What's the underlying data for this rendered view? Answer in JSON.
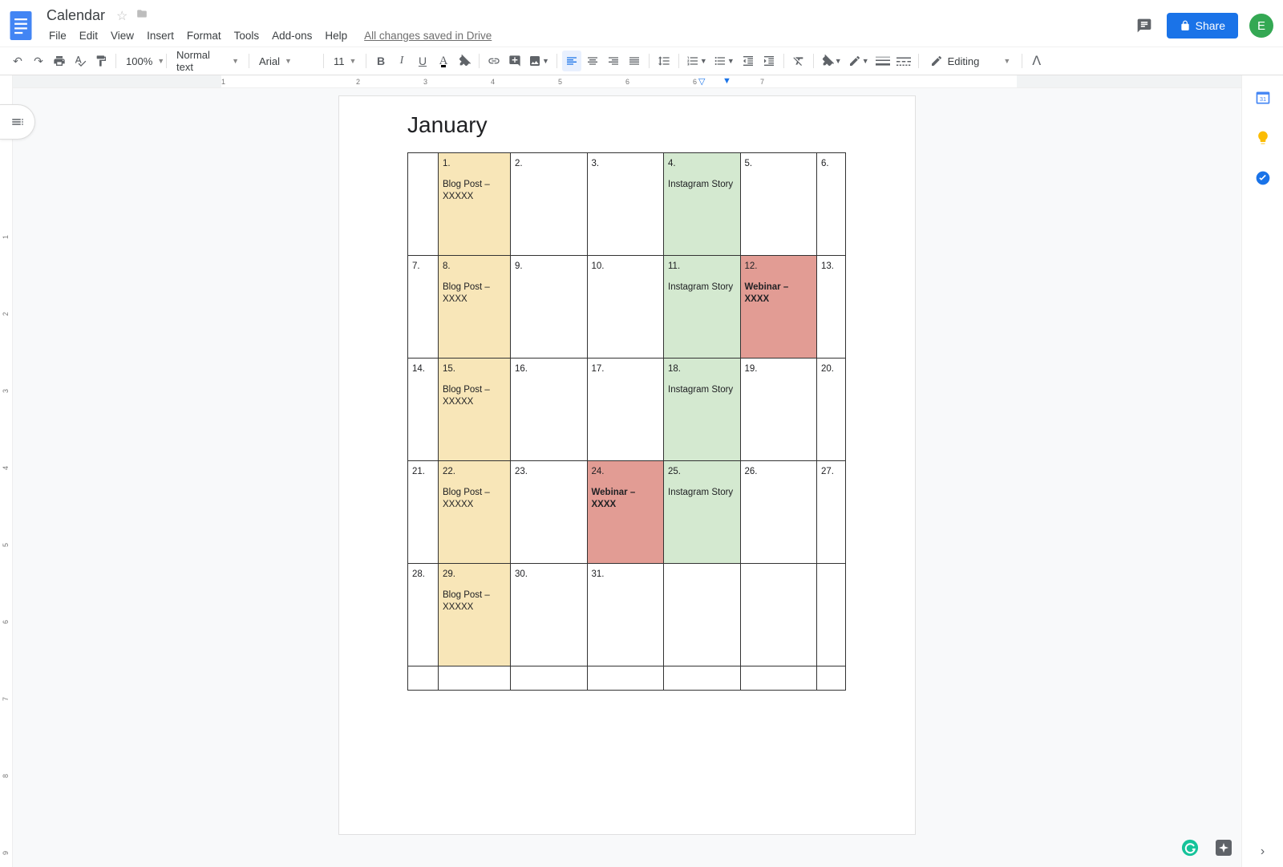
{
  "header": {
    "doc_title": "Calendar",
    "save_status": "All changes saved in Drive",
    "menus": [
      "File",
      "Edit",
      "View",
      "Insert",
      "Format",
      "Tools",
      "Add-ons",
      "Help"
    ],
    "share_label": "Share",
    "avatar_letter": "E"
  },
  "toolbar": {
    "zoom": "100%",
    "style": "Normal text",
    "font": "Arial",
    "size": "11",
    "mode": "Editing"
  },
  "ruler": {
    "top_numbers": [
      "1",
      "2",
      "3",
      "4",
      "5",
      "6",
      "7"
    ],
    "left_numbers": [
      "1",
      "2",
      "3",
      "4",
      "5",
      "6",
      "7",
      "8",
      "9"
    ]
  },
  "document": {
    "title": "January",
    "calendar": {
      "colors": {
        "blog": "bg-yellow",
        "insta": "bg-green",
        "webinar": "bg-red"
      },
      "rows": [
        [
          {
            "num": "",
            "text": "",
            "bg": ""
          },
          {
            "num": "1.",
            "text": "Blog Post  – XXXXX",
            "bg": "blog"
          },
          {
            "num": "2.",
            "text": "",
            "bg": ""
          },
          {
            "num": "3.",
            "text": "",
            "bg": ""
          },
          {
            "num": "4.",
            "text": "Instagram Story",
            "bg": "insta"
          },
          {
            "num": "5.",
            "text": "",
            "bg": ""
          },
          {
            "num": "6.",
            "text": "",
            "bg": ""
          }
        ],
        [
          {
            "num": "7.",
            "text": "",
            "bg": ""
          },
          {
            "num": "8.",
            "text": "Blog Post – XXXX",
            "bg": "blog"
          },
          {
            "num": "9.",
            "text": "",
            "bg": ""
          },
          {
            "num": "10.",
            "text": "",
            "bg": ""
          },
          {
            "num": "11.",
            "text": "Instagram Story",
            "bg": "insta"
          },
          {
            "num": "12.",
            "text": "Webinar – XXXX",
            "bg": "webinar",
            "bold": true
          },
          {
            "num": "13.",
            "text": "",
            "bg": ""
          }
        ],
        [
          {
            "num": "14.",
            "text": "",
            "bg": ""
          },
          {
            "num": "15.",
            "text": "Blog Post  – XXXXX",
            "bg": "blog"
          },
          {
            "num": "16.",
            "text": "",
            "bg": ""
          },
          {
            "num": "17.",
            "text": "",
            "bg": ""
          },
          {
            "num": "18.",
            "text": "Instagram Story",
            "bg": "insta"
          },
          {
            "num": "19.",
            "text": "",
            "bg": ""
          },
          {
            "num": "20.",
            "text": "",
            "bg": ""
          }
        ],
        [
          {
            "num": "21.",
            "text": "",
            "bg": ""
          },
          {
            "num": "22.",
            "text": "Blog Post  – XXXXX",
            "bg": "blog"
          },
          {
            "num": "23.",
            "text": "",
            "bg": ""
          },
          {
            "num": "24.",
            "text": "Webinar – XXXX",
            "bg": "webinar",
            "bold": true
          },
          {
            "num": "25.",
            "text": "Instagram Story",
            "bg": "insta"
          },
          {
            "num": "26.",
            "text": "",
            "bg": ""
          },
          {
            "num": "27.",
            "text": "",
            "bg": ""
          }
        ],
        [
          {
            "num": "28.",
            "text": "",
            "bg": ""
          },
          {
            "num": "29.",
            "text": "Blog Post  – XXXXX",
            "bg": "blog"
          },
          {
            "num": "30.",
            "text": "",
            "bg": ""
          },
          {
            "num": "31.",
            "text": "",
            "bg": ""
          },
          {
            "num": "",
            "text": "",
            "bg": ""
          },
          {
            "num": "",
            "text": "",
            "bg": ""
          },
          {
            "num": "",
            "text": "",
            "bg": ""
          }
        ],
        [
          {
            "num": "",
            "text": "",
            "bg": ""
          },
          {
            "num": "",
            "text": "",
            "bg": ""
          },
          {
            "num": "",
            "text": "",
            "bg": ""
          },
          {
            "num": "",
            "text": "",
            "bg": ""
          },
          {
            "num": "",
            "text": "",
            "bg": ""
          },
          {
            "num": "",
            "text": "",
            "bg": ""
          },
          {
            "num": "",
            "text": "",
            "bg": ""
          }
        ]
      ]
    }
  }
}
